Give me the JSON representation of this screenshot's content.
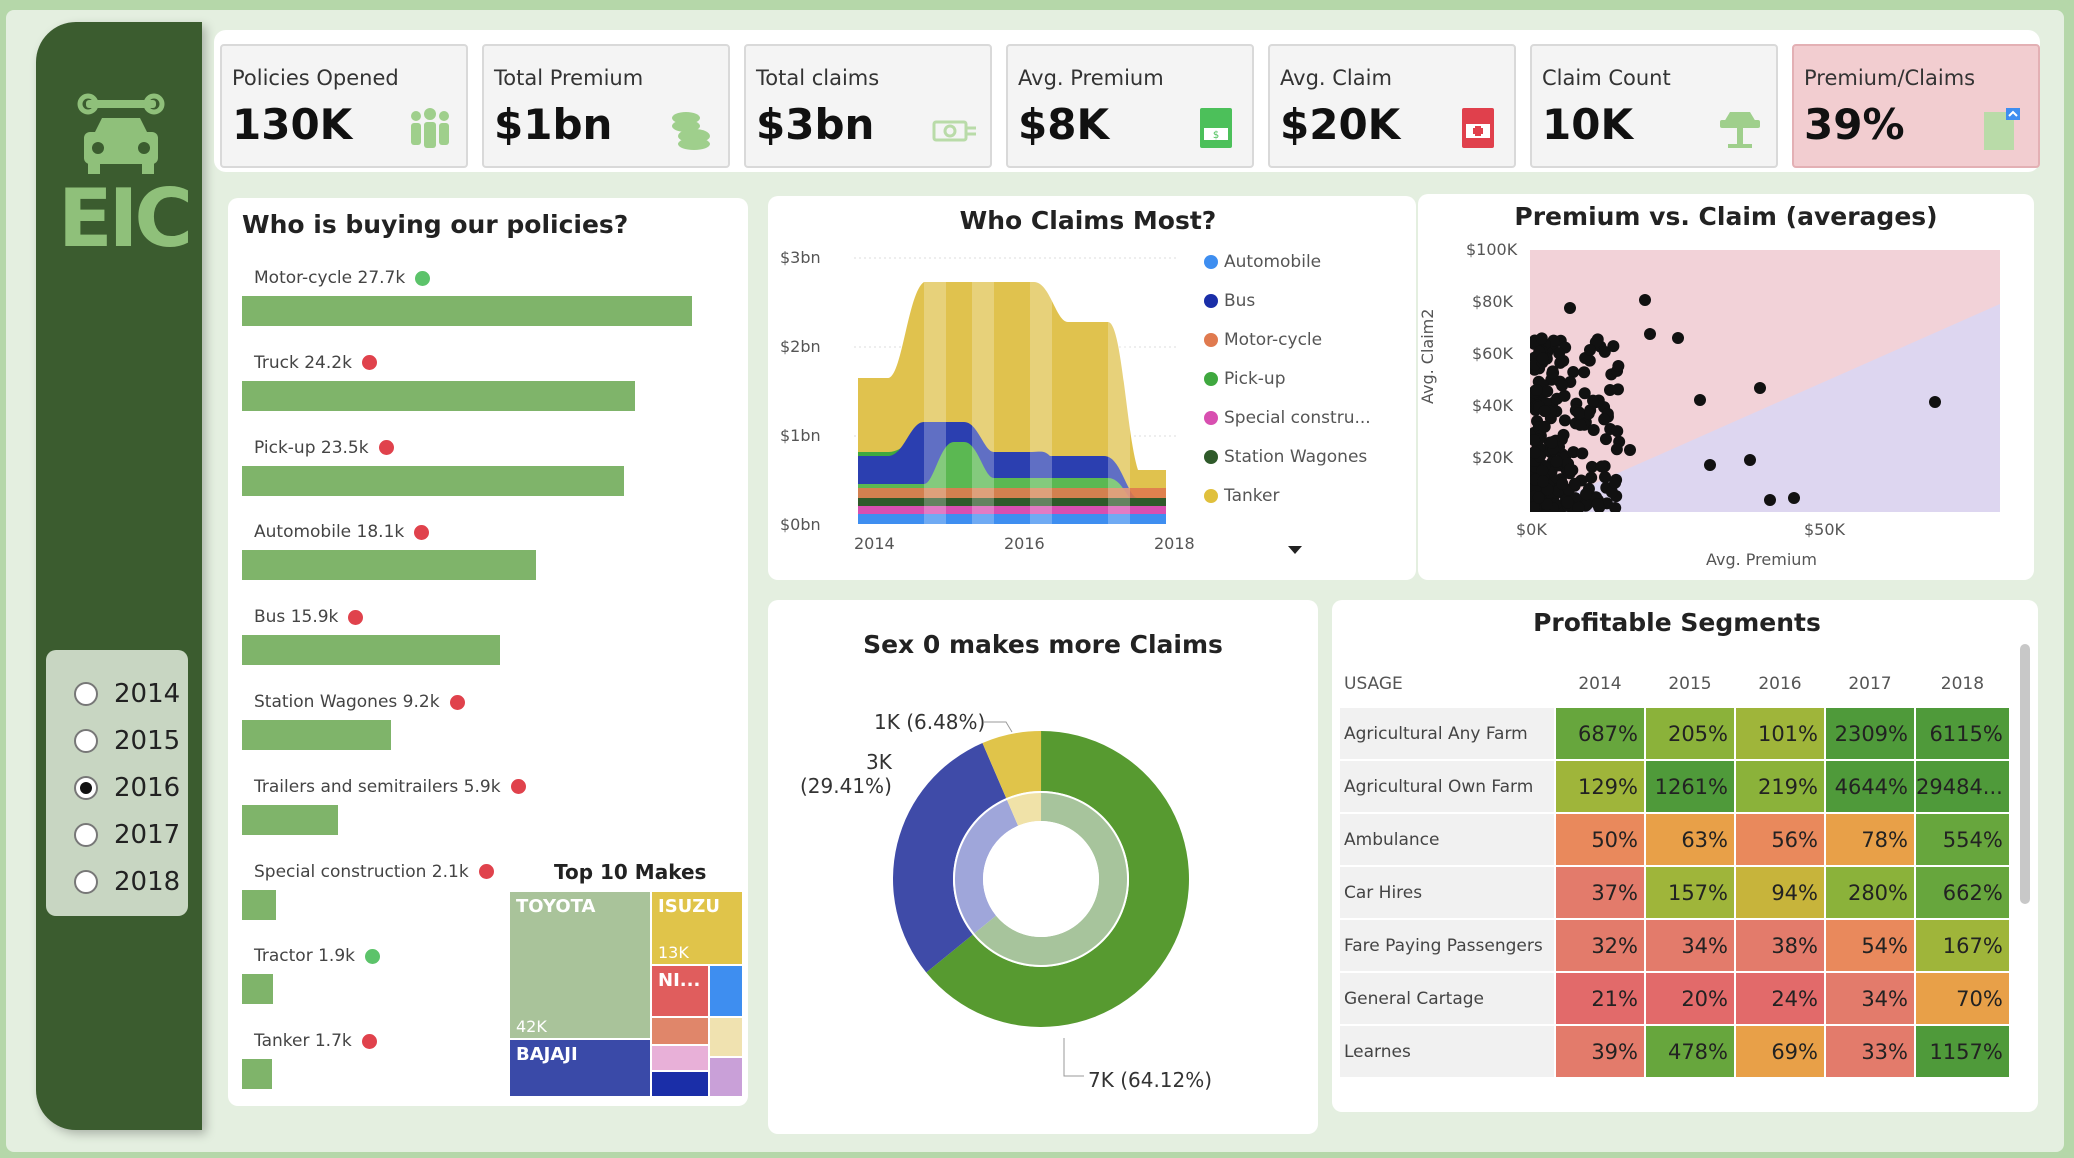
{
  "brand": {
    "name": "EIC"
  },
  "slicer": {
    "years": [
      "2014",
      "2015",
      "2016",
      "2017",
      "2018"
    ],
    "selected": "2016"
  },
  "kpis": [
    {
      "label": "Policies Opened",
      "value": "130K",
      "icon": "people-icon"
    },
    {
      "label": "Total Premium",
      "value": "$1bn",
      "icon": "coins-icon"
    },
    {
      "label": "Total claims",
      "value": "$3bn",
      "icon": "cash-icon"
    },
    {
      "label": "Avg. Premium",
      "value": "$8K",
      "icon": "document-money-icon"
    },
    {
      "label": "Avg. Claim",
      "value": "$20K",
      "icon": "document-claim-icon"
    },
    {
      "label": "Claim Count",
      "value": "10K",
      "icon": "car-lift-icon"
    },
    {
      "label": "Premium/Claims",
      "value": "39%",
      "icon": "report-icon"
    }
  ],
  "buyers": {
    "title": "Who is buying our policies?",
    "items": [
      {
        "label": "Motor-cycle 27.7k",
        "value": 27.7,
        "status": "#5cc36a"
      },
      {
        "label": "Truck 24.2k",
        "value": 24.2,
        "status": "#e0424c"
      },
      {
        "label": "Pick-up 23.5k",
        "value": 23.5,
        "status": "#e0424c"
      },
      {
        "label": "Automobile 18.1k",
        "value": 18.1,
        "status": "#e0424c"
      },
      {
        "label": "Bus 15.9k",
        "value": 15.9,
        "status": "#e0424c"
      },
      {
        "label": "Station Wagones 9.2k",
        "value": 9.2,
        "status": "#e0424c"
      },
      {
        "label": "Trailers and semitrailers 5.9k",
        "value": 5.9,
        "status": "#e0424c"
      },
      {
        "label": "Special construction 2.1k",
        "value": 2.1,
        "status": "#e0424c"
      },
      {
        "label": "Tractor 1.9k",
        "value": 1.9,
        "status": "#5cc36a"
      },
      {
        "label": "Tanker 1.7k",
        "value": 1.7,
        "status": "#e0424c"
      }
    ]
  },
  "makes": {
    "title": "Top 10 Makes",
    "toyota": "TOYOTA",
    "toyota_value": "42K",
    "isuzu": "ISUZU",
    "isuzu_value": "13K",
    "nissan": "NI...",
    "bajaji": "BAJAJI"
  },
  "claims_most": {
    "title": "Who Claims Most?",
    "y_ticks": [
      "$3bn",
      "$2bn",
      "$1bn",
      "$0bn"
    ],
    "x_ticks": [
      "2014",
      "2016",
      "2018"
    ],
    "legend": [
      {
        "name": "Automobile",
        "color": "#3e8ef0"
      },
      {
        "name": "Bus",
        "color": "#1a2ea8"
      },
      {
        "name": "Motor-cycle",
        "color": "#e07a4f"
      },
      {
        "name": "Pick-up",
        "color": "#3fa83f"
      },
      {
        "name": "Special constru...",
        "color": "#d84fb0"
      },
      {
        "name": "Station Wagones",
        "color": "#2f5a2a"
      },
      {
        "name": "Tanker",
        "color": "#e0c03c"
      }
    ]
  },
  "scatter": {
    "title": "Premium vs. Claim (averages)",
    "xlabel": "Avg. Premium",
    "ylabel": "Avg. Claim2",
    "y_ticks": [
      "$100K",
      "$80K",
      "$60K",
      "$40K",
      "$20K"
    ],
    "x_ticks": [
      "$0K",
      "$50K"
    ]
  },
  "donut": {
    "title": "Sex 0 makes more Claims",
    "labels": [
      {
        "text": "1K (6.48%)"
      },
      {
        "text": "3K"
      },
      {
        "text": "(29.41%)"
      },
      {
        "text": "7K (64.12%)"
      }
    ]
  },
  "segments": {
    "title": "Profitable Segments",
    "header": [
      "USAGE",
      "2014",
      "2015",
      "2016",
      "2017",
      "2018"
    ],
    "rows": [
      {
        "usage": "Agricultural Any Farm",
        "vals": [
          "687%",
          "205%",
          "101%",
          "2309%",
          "6115%"
        ]
      },
      {
        "usage": "Agricultural Own Farm",
        "vals": [
          "129%",
          "1261%",
          "219%",
          "4644%",
          "29484..."
        ]
      },
      {
        "usage": "Ambulance",
        "vals": [
          "50%",
          "63%",
          "56%",
          "78%",
          "554%"
        ]
      },
      {
        "usage": "Car Hires",
        "vals": [
          "37%",
          "157%",
          "94%",
          "280%",
          "662%"
        ]
      },
      {
        "usage": "Fare Paying Passengers",
        "vals": [
          "32%",
          "34%",
          "38%",
          "54%",
          "167%"
        ]
      },
      {
        "usage": "General Cartage",
        "vals": [
          "21%",
          "20%",
          "24%",
          "34%",
          "70%"
        ]
      },
      {
        "usage": "Learnes",
        "vals": [
          "39%",
          "478%",
          "69%",
          "33%",
          "1157%"
        ]
      }
    ]
  }
}
